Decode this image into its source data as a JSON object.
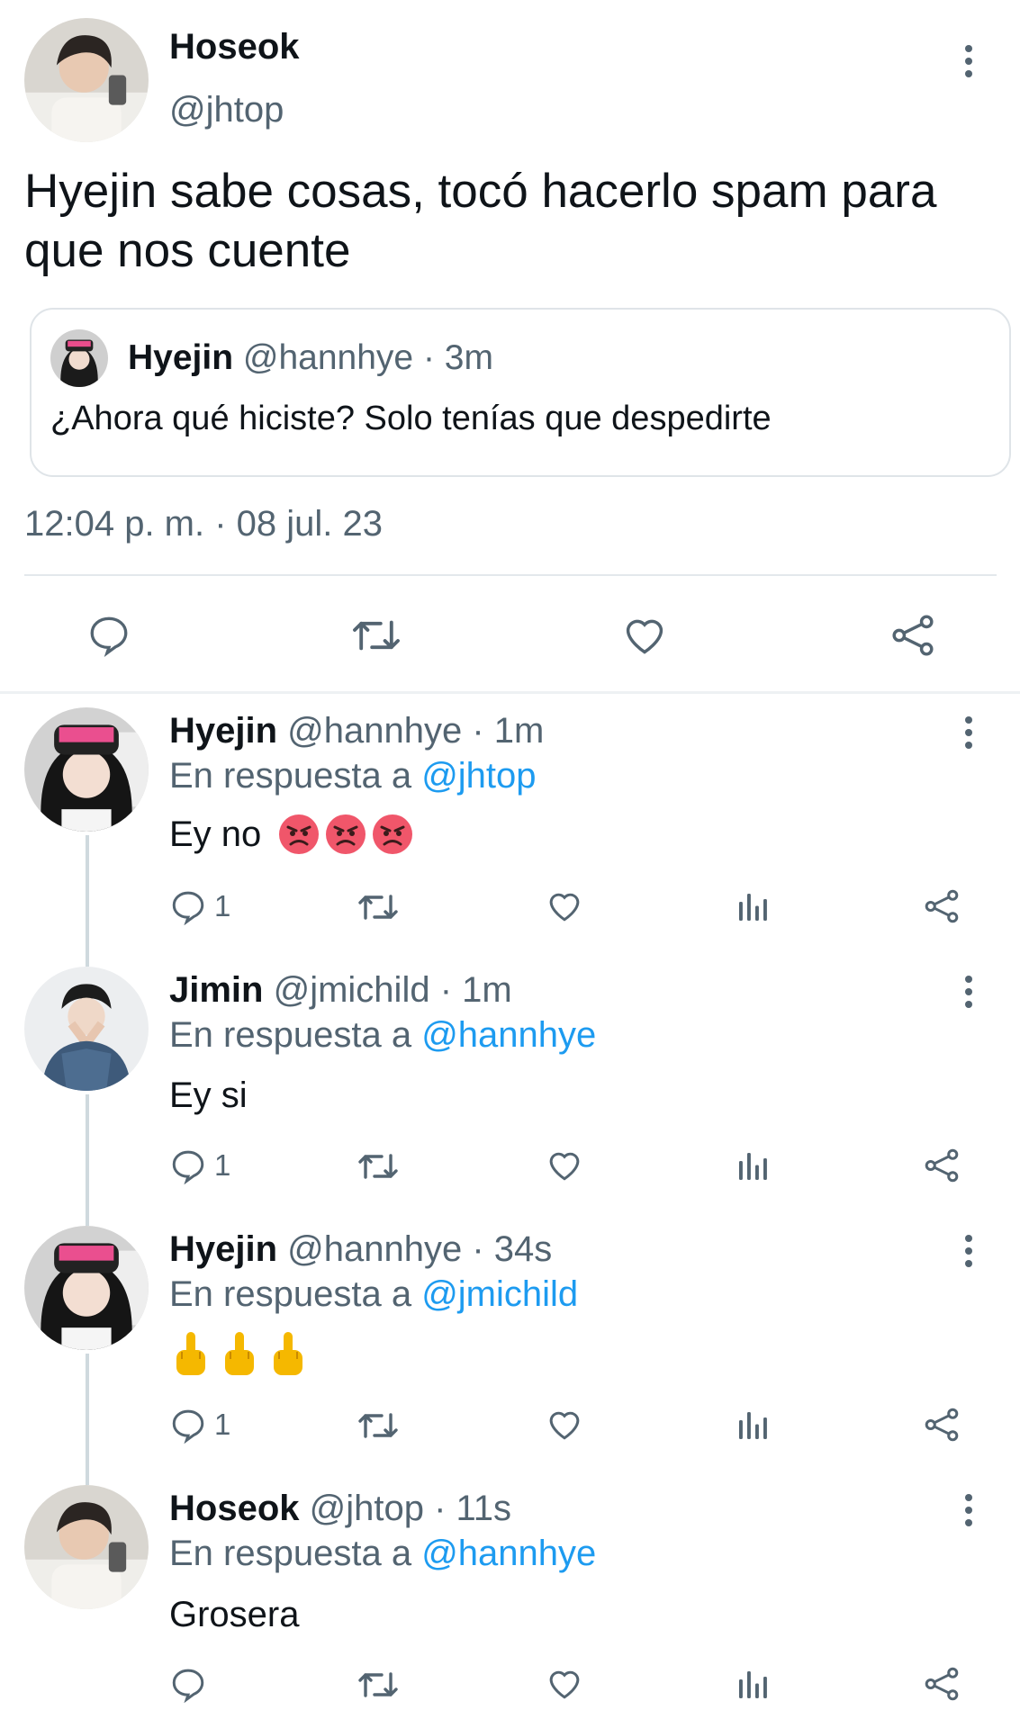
{
  "main_tweet": {
    "author_name": "Hoseok",
    "author_handle": "@jhtop",
    "text_line1": "Hyejin sabe cosas, tocó hacerlo spam para",
    "text_line2": "que nos cuente",
    "quoted": {
      "author_name": "Hyejin",
      "author_meta": "@hannhye · 3m",
      "text": "¿Ahora qué hiciste? Solo tenías que despedirte"
    },
    "timestamp": "12:04 p. m. · 08 jul. 23"
  },
  "replies": [
    {
      "author_name": "Hyejin",
      "meta": "@hannhye · 1m",
      "reply_prefix": "En respuesta a ",
      "reply_to": "@jhtop",
      "text": "Ey no",
      "emojis": [
        "angry-face",
        "angry-face",
        "angry-face"
      ],
      "reply_count": "1"
    },
    {
      "author_name": "Jimin",
      "meta": "@jmichild · 1m",
      "reply_prefix": "En respuesta a ",
      "reply_to": "@hannhye",
      "text": "Ey si",
      "reply_count": "1"
    },
    {
      "author_name": "Hyejin",
      "meta": "@hannhye · 34s",
      "reply_prefix": "En respuesta a ",
      "reply_to": "@jmichild",
      "text": "",
      "emojis": [
        "middle-finger",
        "middle-finger",
        "middle-finger"
      ],
      "reply_count": "1"
    },
    {
      "author_name": "Hoseok",
      "meta": "@jhtop · 11s",
      "reply_prefix": "En respuesta a ",
      "reply_to": "@hannhye",
      "text": "Grosera",
      "reply_count": ""
    }
  ],
  "colors": {
    "link": "#1d9bf0",
    "muted": "#536471",
    "angry_emoji": "#f0566a",
    "finger_emoji": "#f5b800"
  },
  "icons": [
    "more-vertical-icon",
    "comment-icon",
    "retweet-icon",
    "heart-icon",
    "share-icon",
    "stats-icon"
  ]
}
